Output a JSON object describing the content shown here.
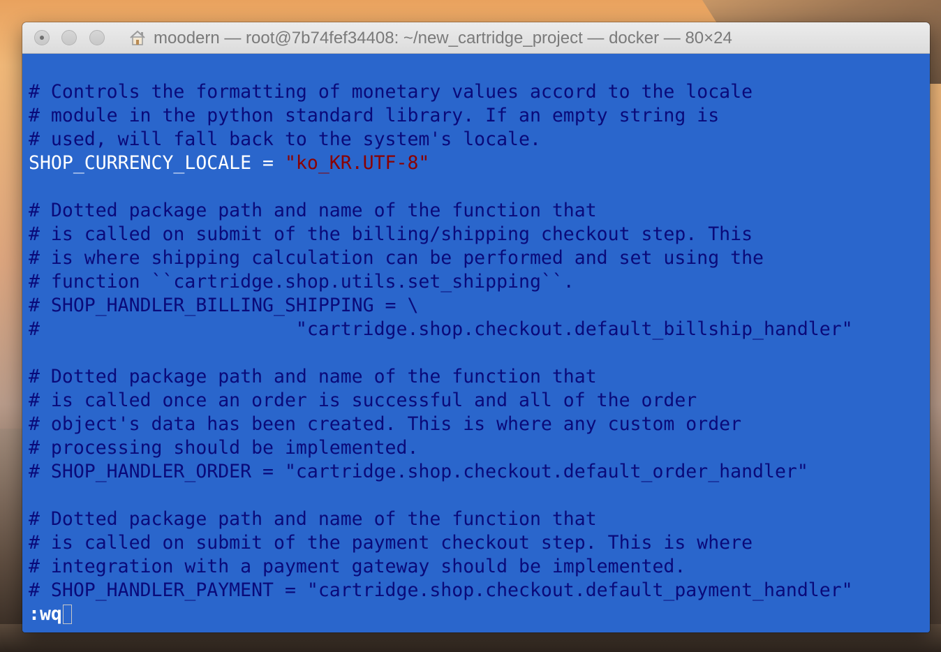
{
  "window": {
    "title": "moodern — root@7b74fef34408: ~/new_cartridge_project — docker — 80×24"
  },
  "editor": {
    "lines": [
      "",
      "# Controls the formatting of monetary values accord to the locale",
      "# module in the python standard library. If an empty string is",
      "# used, will fall back to the system's locale.",
      "",
      "",
      "# Dotted package path and name of the function that",
      "# is called on submit of the billing/shipping checkout step. This",
      "# is where shipping calculation can be performed and set using the",
      "# function ``cartridge.shop.utils.set_shipping``.",
      "# SHOP_HANDLER_BILLING_SHIPPING = \\",
      "#                       \"cartridge.shop.checkout.default_billship_handler\"",
      "",
      "# Dotted package path and name of the function that",
      "# is called once an order is successful and all of the order",
      "# object's data has been created. This is where any custom order",
      "# processing should be implemented.",
      "# SHOP_HANDLER_ORDER = \"cartridge.shop.checkout.default_order_handler\"",
      "",
      "# Dotted package path and name of the function that",
      "# is called on submit of the payment checkout step. This is where",
      "# integration with a payment gateway should be implemented.",
      "# SHOP_HANDLER_PAYMENT = \"cartridge.shop.checkout.default_payment_handler\""
    ],
    "setting_line": {
      "name": "SHOP_CURRENCY_LOCALE",
      "operator": " = ",
      "value": "\"ko_KR.UTF-8\""
    },
    "command": ":wq"
  },
  "colors": {
    "background": "#2a66cc",
    "comment": "#0a0a7a",
    "identifier": "#ffffff",
    "string": "#8a0000"
  }
}
